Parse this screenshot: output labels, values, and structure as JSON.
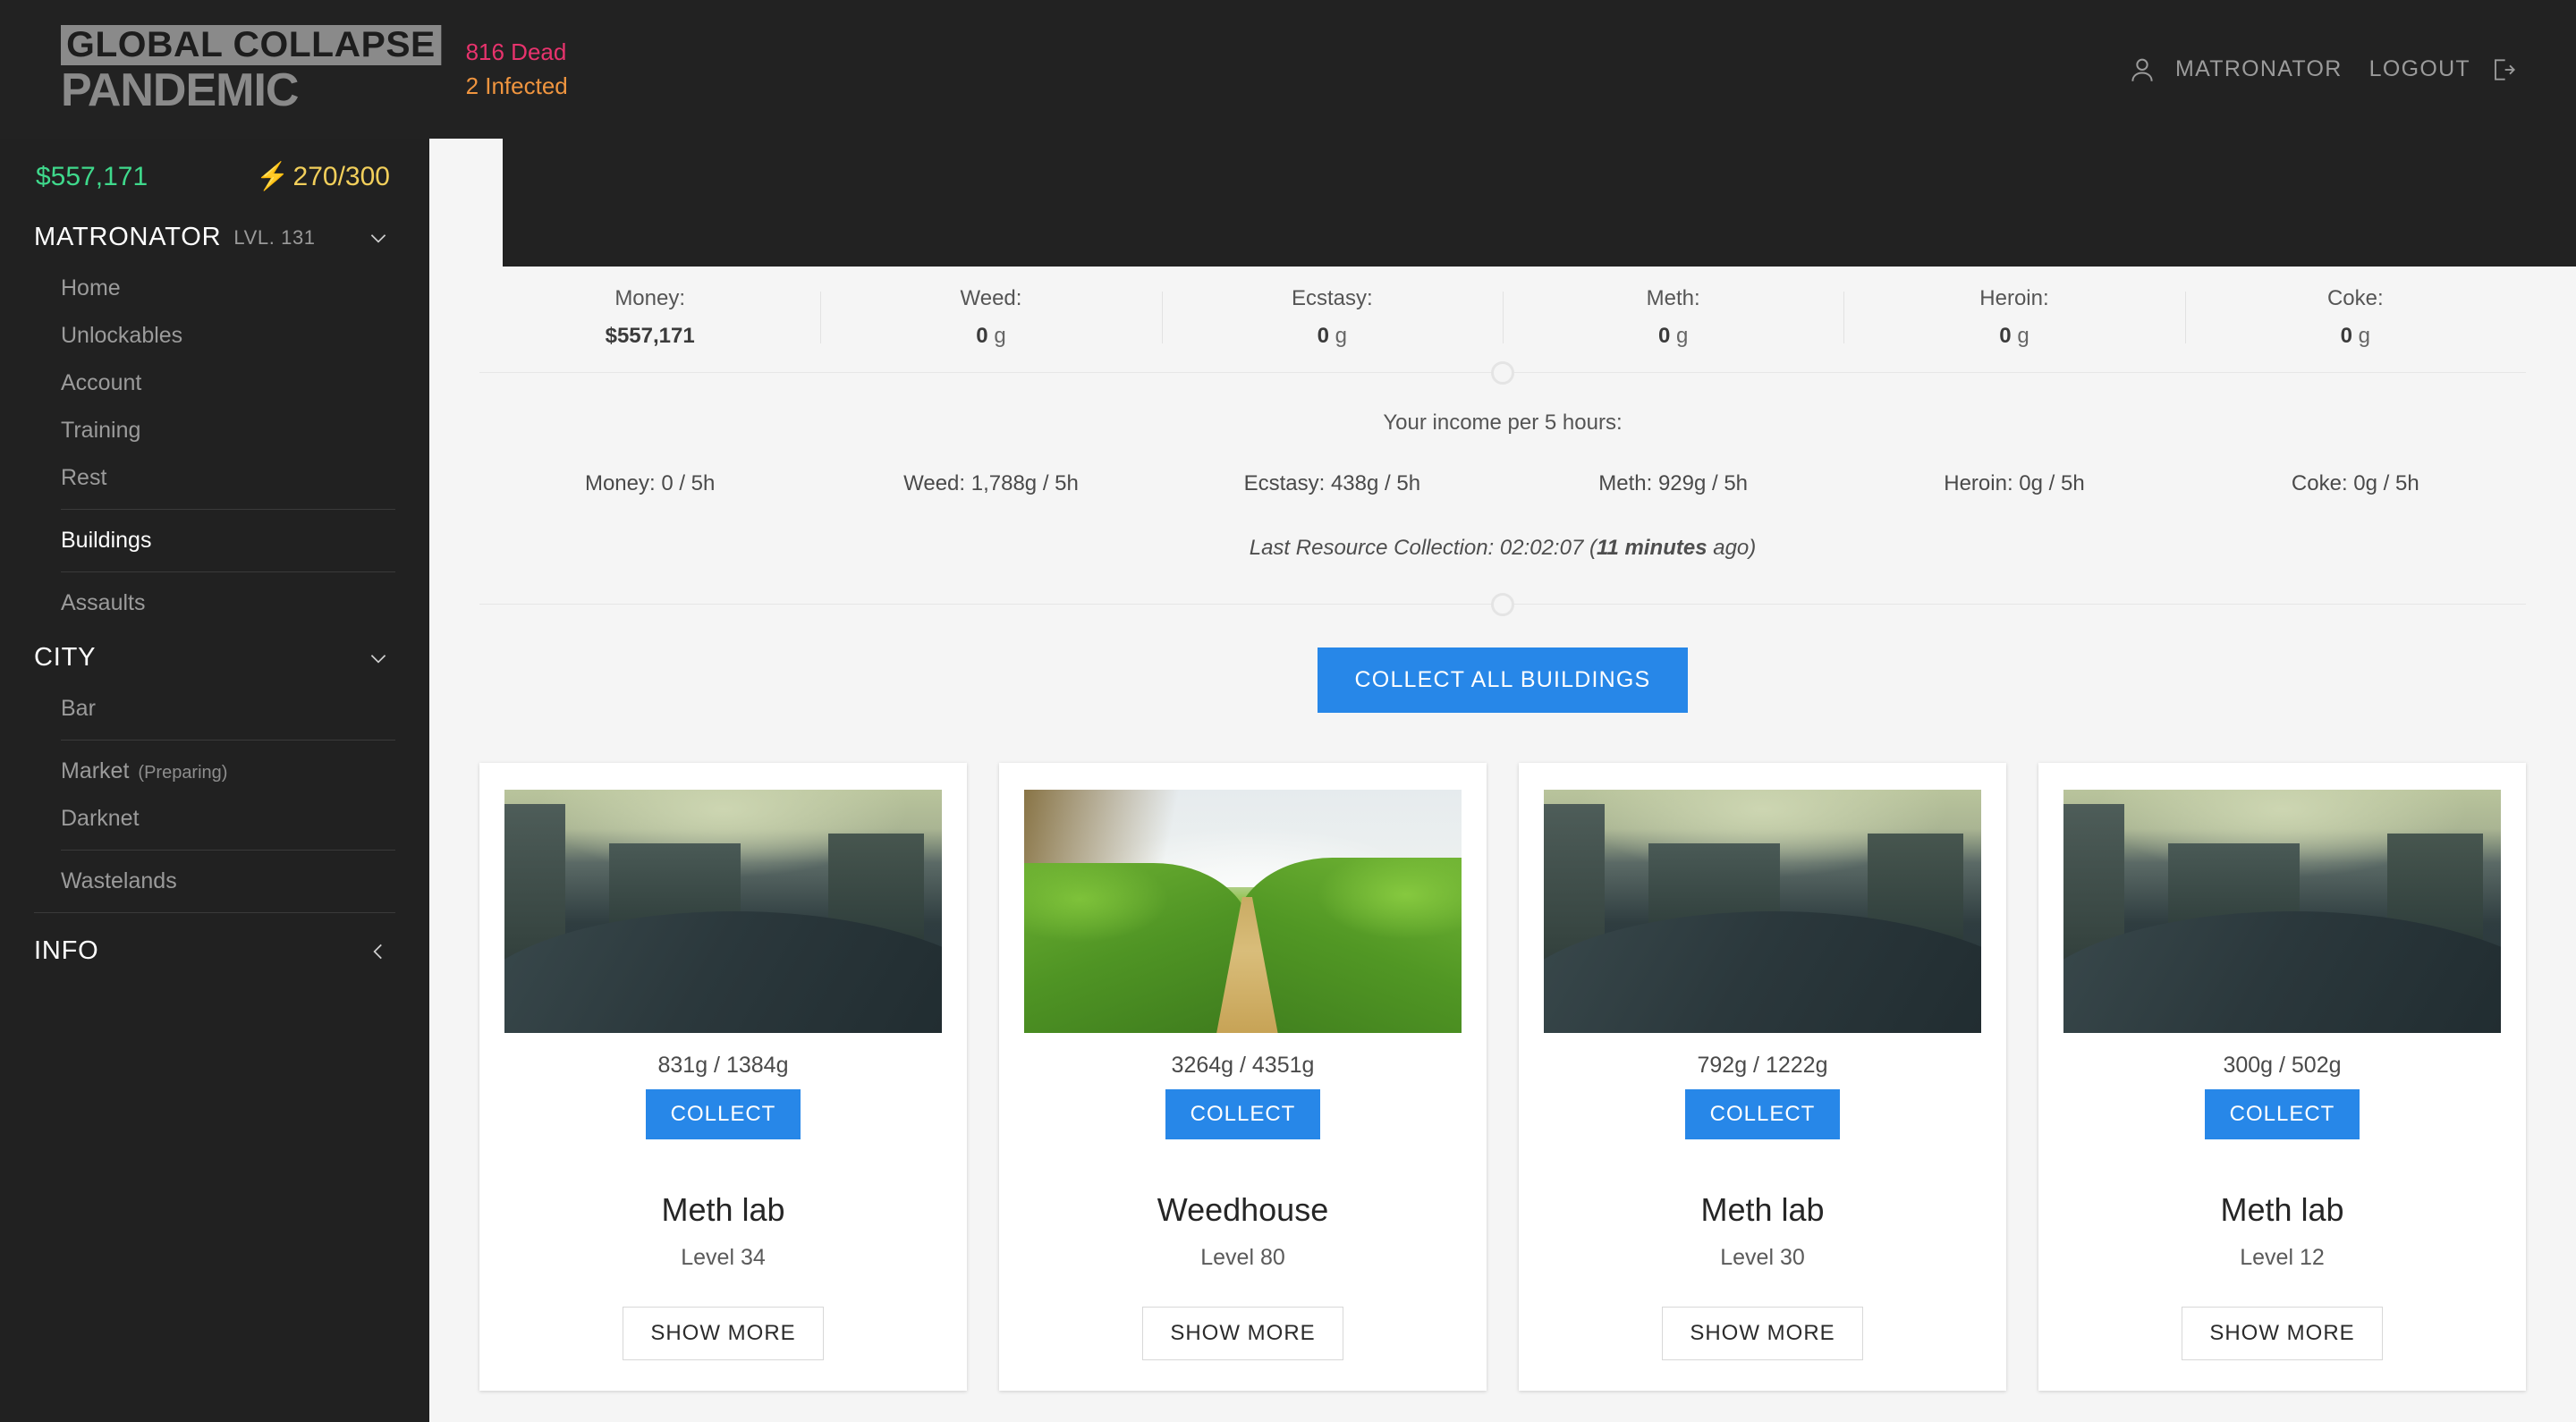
{
  "header": {
    "logo_line1": "GLOBAL COLLAPSE",
    "logo_line2": "PANDEMIC",
    "dead": "816 Dead",
    "infected": "2 Infected",
    "user_name": "MATRONATOR",
    "logout_label": "LOGOUT",
    "user_icon": "person-icon",
    "logout_icon": "logout-arrow-icon"
  },
  "sidebar": {
    "money": "$557,171",
    "energy": "270/300",
    "bolt_icon": "lightning-bolt-icon",
    "player": {
      "name": "MATRONATOR",
      "level": "LVL. 131",
      "chevron": "chevron-down-icon"
    },
    "player_items": [
      {
        "label": "Home"
      },
      {
        "label": "Unlockables"
      },
      {
        "label": "Account"
      },
      {
        "label": "Training"
      },
      {
        "label": "Rest"
      }
    ],
    "buildings_label": "Buildings",
    "assaults_label": "Assaults",
    "city": {
      "title": "CITY",
      "chevron": "chevron-down-icon"
    },
    "city_items_a": [
      {
        "label": "Bar"
      }
    ],
    "city_items_b": [
      {
        "label": "Market",
        "sub": "(Preparing)"
      },
      {
        "label": "Darknet",
        "sub": ""
      }
    ],
    "city_items_c": [
      {
        "label": "Wastelands"
      }
    ],
    "info": {
      "title": "INFO",
      "chevron": "chevron-left-icon"
    }
  },
  "main": {
    "stats": [
      {
        "label": "Money:",
        "value": "$557,171",
        "unit": ""
      },
      {
        "label": "Weed:",
        "value": "0",
        "unit": "g"
      },
      {
        "label": "Ecstasy:",
        "value": "0",
        "unit": "g"
      },
      {
        "label": "Meth:",
        "value": "0",
        "unit": "g"
      },
      {
        "label": "Heroin:",
        "value": "0",
        "unit": "g"
      },
      {
        "label": "Coke:",
        "value": "0",
        "unit": "g"
      }
    ],
    "income_title": "Your income per 5 hours:",
    "income": [
      {
        "text": "Money: 0 / 5h"
      },
      {
        "text": "Weed: 1,788g / 5h"
      },
      {
        "text": "Ecstasy: 438g / 5h"
      },
      {
        "text": "Meth: 929g / 5h"
      },
      {
        "text": "Heroin: 0g / 5h"
      },
      {
        "text": "Coke: 0g / 5h"
      }
    ],
    "last_collection_prefix": "Last Resource Collection: 02:02:07 (",
    "last_collection_bold": "11 minutes",
    "last_collection_suffix": " ago)",
    "collect_all_label": "COLLECT ALL BUILDINGS",
    "collect_label": "COLLECT",
    "show_more_label": "SHOW MORE",
    "cards": [
      {
        "amount": "831g / 1384g",
        "title": "Meth lab",
        "level": "Level 34",
        "image": "meth-lab-image"
      },
      {
        "amount": "3264g / 4351g",
        "title": "Weedhouse",
        "level": "Level 80",
        "image": "weedhouse-image"
      },
      {
        "amount": "792g / 1222g",
        "title": "Meth lab",
        "level": "Level 30",
        "image": "meth-lab-image"
      },
      {
        "amount": "300g / 502g",
        "title": "Meth lab",
        "level": "Level 12",
        "image": "meth-lab-image"
      }
    ]
  },
  "colors": {
    "accent_blue": "#2787e8",
    "money_green": "#3fd98c",
    "energy_yellow": "#f2cf5b",
    "dead_pink": "#e8336d",
    "infected_orange": "#f0953f",
    "dark_bg": "#212121"
  }
}
